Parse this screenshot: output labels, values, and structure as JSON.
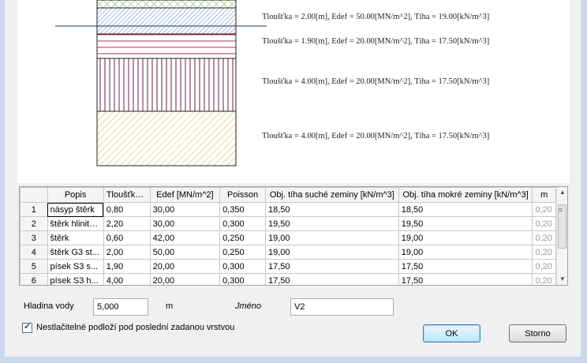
{
  "layers_preview": [
    {
      "label": "Tloušťka = 2.00[m], Edef = 50.00[MN/m^2], Tíha = 19.00[kN/m^3]",
      "pattern": "hatch-tight",
      "color": "#4a7ab3"
    },
    {
      "label": "Tloušťka = 1.90[m], Edef = 20.00[MN/m^2], Tíha = 17.50[kN/m^3]",
      "pattern": "horizontal-lines",
      "color": "#b0305a"
    },
    {
      "label": "Tloušťka = 4.00[m], Edef = 20.00[MN/m^2], Tíha = 17.50[kN/m^3]",
      "pattern": "vertical-lines",
      "color": "#6a1f4a"
    },
    {
      "label": "Tloušťka = 4.00[m], Edef = 20.00[MN/m^2], Tíha = 17.50[kN/m^3]",
      "pattern": "diagonal-hatch",
      "color": "#c9b63a"
    }
  ],
  "table": {
    "headers": [
      "",
      "Popis",
      "Tloušťka [m]",
      "Edef [MN/m^2]",
      "Poisson",
      "Obj. tíha suché zeminy [kN/m^3]",
      "Obj. tíha mokré zeminy [kN/m^3]",
      "m"
    ],
    "rows": [
      {
        "n": "1",
        "popis": "násyp štěrk",
        "tl": "0,80",
        "edef": "30,00",
        "poisson": "0,350",
        "sucha": "18,50",
        "mokra": "18,50",
        "m": "0,20"
      },
      {
        "n": "2",
        "popis": "štěrk hlinitý...",
        "tl": "2,20",
        "edef": "30,00",
        "poisson": "0,300",
        "sucha": "19,50",
        "mokra": "19,50",
        "m": "0,20"
      },
      {
        "n": "3",
        "popis": "štěrk",
        "tl": "0,60",
        "edef": "42,00",
        "poisson": "0,250",
        "sucha": "19,00",
        "mokra": "19,00",
        "m": "0,20"
      },
      {
        "n": "4",
        "popis": "štěrk G3 st...",
        "tl": "2,00",
        "edef": "50,00",
        "poisson": "0,250",
        "sucha": "19,00",
        "mokra": "19,00",
        "m": "0,20"
      },
      {
        "n": "5",
        "popis": "písek S3 s...",
        "tl": "1,90",
        "edef": "20,00",
        "poisson": "0,300",
        "sucha": "17,50",
        "mokra": "17,50",
        "m": "0,20"
      },
      {
        "n": "6",
        "popis": "písek S3 h...",
        "tl": "4,00",
        "edef": "20,00",
        "poisson": "0,300",
        "sucha": "17,50",
        "mokra": "17,50",
        "m": "0,20"
      }
    ]
  },
  "form": {
    "water_label": "Hladina vody",
    "water_value": "5,000",
    "water_unit": "m",
    "name_label": "Jméno",
    "name_value": "V2",
    "checkbox_label": "Nestlačitelné podloží pod poslední zadanou vrstvou",
    "checkbox_checked": true
  },
  "buttons": {
    "ok": "OK",
    "cancel": "Storno"
  }
}
